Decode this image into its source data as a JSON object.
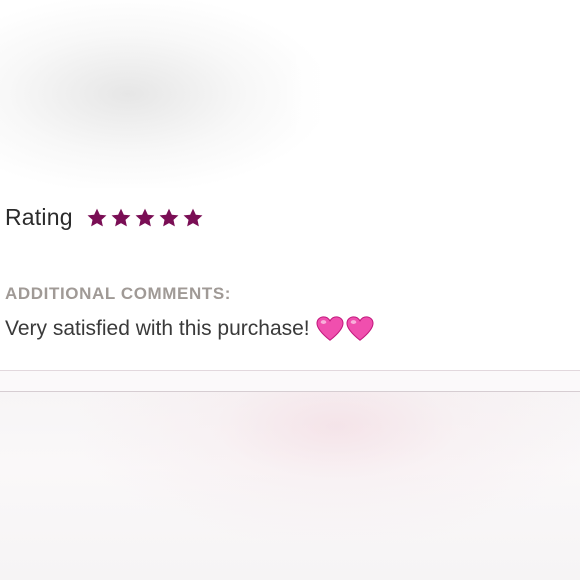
{
  "review": {
    "rating_label": "Rating",
    "rating": {
      "value": 5,
      "max": 5
    },
    "star_color": "#7a0e55",
    "comments_heading": "ADDITIONAL COMMENTS:",
    "comment_text": "Very satisfied with this purchase!",
    "comment_emoji": [
      "pink-heart-icon",
      "pink-heart-icon"
    ],
    "heart_color": "#f04fae"
  }
}
